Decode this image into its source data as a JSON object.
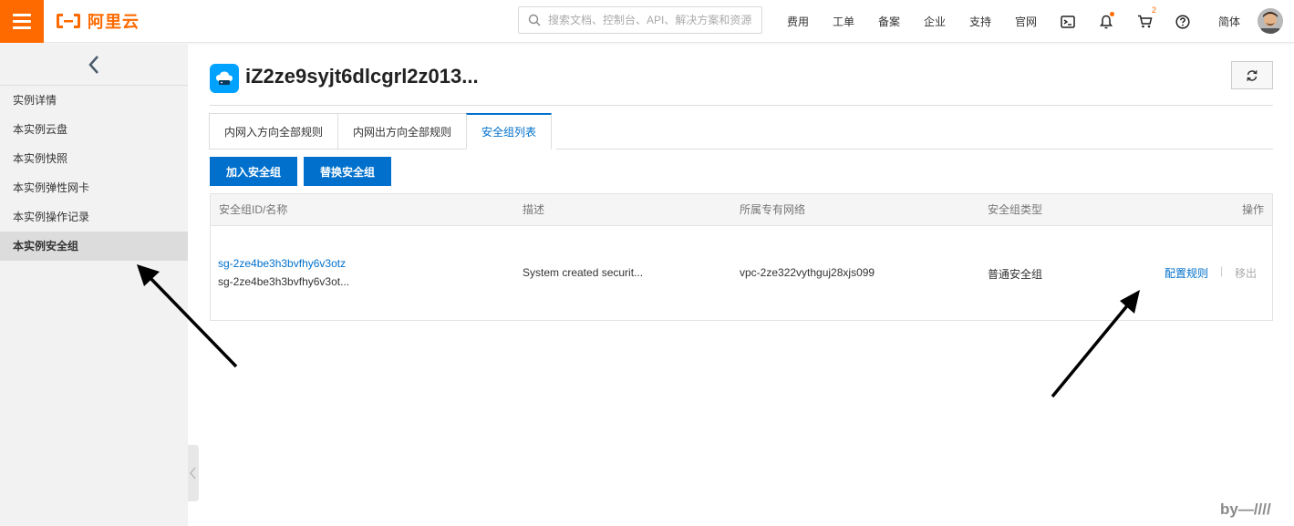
{
  "topbar": {
    "logo_text": "阿里云",
    "search_placeholder": "搜索文档、控制台、API、解决方案和资源",
    "nav": [
      "费用",
      "工单",
      "备案",
      "企业",
      "支持",
      "官网"
    ],
    "cart_count": "2",
    "lang": "简体",
    "accent": "#ff6a00"
  },
  "sidebar": {
    "items": [
      {
        "label": "实例详情"
      },
      {
        "label": "本实例云盘"
      },
      {
        "label": "本实例快照"
      },
      {
        "label": "本实例弹性网卡"
      },
      {
        "label": "本实例操作记录"
      },
      {
        "label": "本实例安全组",
        "active": true
      }
    ]
  },
  "header": {
    "title": "iZ2ze9syjt6dlcgrl2z013..."
  },
  "tabs": [
    {
      "label": "内网入方向全部规则"
    },
    {
      "label": "内网出方向全部规则"
    },
    {
      "label": "安全组列表",
      "active": true
    }
  ],
  "actions": {
    "join": "加入安全组",
    "replace": "替换安全组"
  },
  "table": {
    "columns": [
      "安全组ID/名称",
      "描述",
      "所属专有网络",
      "安全组类型",
      "操作"
    ],
    "rows": [
      {
        "id": "sg-2ze4be3h3bvfhy6v3otz",
        "name": "sg-2ze4be3h3bvfhy6v3ot...",
        "description": "System created securit...",
        "vpc": "vpc-2ze322vythguj28xjs099",
        "type": "普通安全组",
        "op_config": "配置规则",
        "op_sep": "|",
        "op_remove": "移出"
      }
    ]
  },
  "watermark": "by—////",
  "colors": {
    "link": "#0070cc",
    "primary": "#0070cc"
  }
}
